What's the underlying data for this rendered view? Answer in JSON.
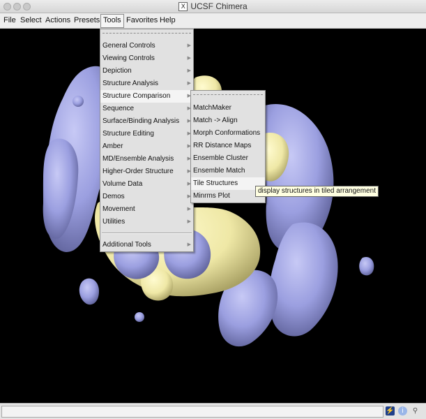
{
  "window": {
    "title": "UCSF Chimera"
  },
  "menubar": {
    "items": [
      "File",
      "Select",
      "Actions",
      "Presets",
      "Tools",
      "Favorites",
      "Help"
    ],
    "active": "Tools"
  },
  "tools_menu": {
    "items": [
      "General Controls",
      "Viewing Controls",
      "Depiction",
      "Structure Analysis",
      "Structure Comparison",
      "Sequence",
      "Surface/Binding Analysis",
      "Structure Editing",
      "Amber",
      "MD/Ensemble Analysis",
      "Higher-Order Structure",
      "Volume Data",
      "Demos",
      "Movement",
      "Utilities"
    ],
    "highlighted": "Structure Comparison",
    "footer_item": "Additional Tools"
  },
  "comparison_submenu": {
    "items": [
      "MatchMaker",
      "Match -> Align",
      "Morph Conformations",
      "RR Distance Maps",
      "Ensemble Cluster",
      "Ensemble Match",
      "Tile Structures",
      "Minrms Plot"
    ],
    "highlighted": "Tile Structures"
  },
  "tooltip": {
    "text": "display structures in tiled arrangement"
  },
  "statusbar": {
    "text": ""
  },
  "icons": {
    "title": "x11-icon",
    "status": [
      "bolt-icon",
      "info-icon",
      "magnifier-icon"
    ]
  },
  "colors": {
    "surface_lavender": "#9b9fe0",
    "surface_yellow": "#efe8a6",
    "background": "#000000"
  }
}
